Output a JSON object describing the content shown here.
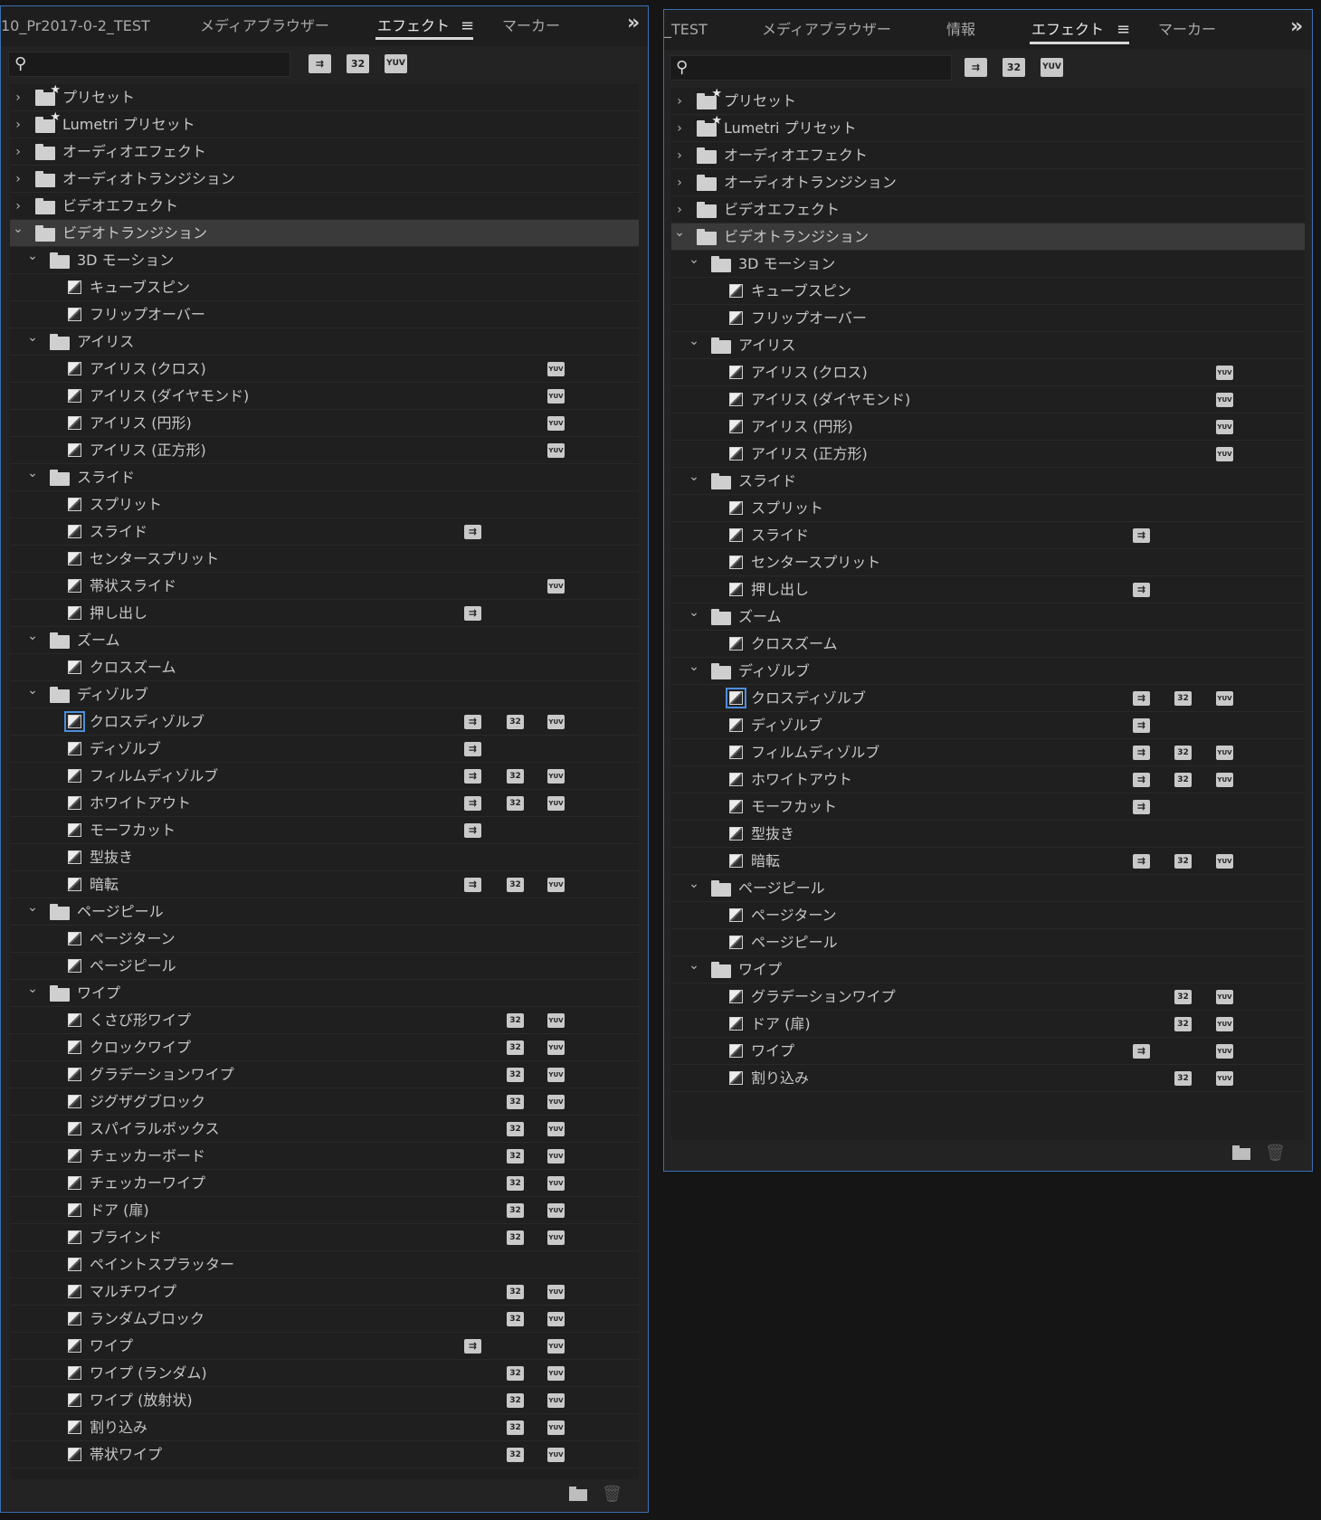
{
  "panel_left": {
    "tabs": [
      "10_Pr2017-0-2_TEST",
      "メディアブラウザー",
      "エフェクト",
      "マーカー"
    ],
    "active_tab": "エフェクト",
    "search": {
      "value": "",
      "placeholder": ""
    },
    "filters": [
      "accelerated",
      "32",
      "YUV"
    ],
    "tree": [
      {
        "type": "folder",
        "level": 0,
        "label": "プリセット",
        "expanded": false,
        "special": true
      },
      {
        "type": "folder",
        "level": 0,
        "label": "Lumetri プリセット",
        "expanded": false,
        "special": true
      },
      {
        "type": "folder",
        "level": 0,
        "label": "オーディオエフェクト",
        "expanded": false
      },
      {
        "type": "folder",
        "level": 0,
        "label": "オーディオトランジション",
        "expanded": false
      },
      {
        "type": "folder",
        "level": 0,
        "label": "ビデオエフェクト",
        "expanded": false
      },
      {
        "type": "folder",
        "level": 0,
        "label": "ビデオトランジション",
        "expanded": true,
        "selected": true
      },
      {
        "type": "folder",
        "level": 1,
        "label": "3D モーション",
        "expanded": true
      },
      {
        "type": "effect",
        "level": 2,
        "label": "キューブスピン",
        "badges": []
      },
      {
        "type": "effect",
        "level": 2,
        "label": "フリップオーバー",
        "badges": []
      },
      {
        "type": "folder",
        "level": 1,
        "label": "アイリス",
        "expanded": true
      },
      {
        "type": "effect",
        "level": 2,
        "label": "アイリス (クロス)",
        "badges": [
          "yuv"
        ]
      },
      {
        "type": "effect",
        "level": 2,
        "label": "アイリス (ダイヤモンド)",
        "badges": [
          "yuv"
        ]
      },
      {
        "type": "effect",
        "level": 2,
        "label": "アイリス (円形)",
        "badges": [
          "yuv"
        ]
      },
      {
        "type": "effect",
        "level": 2,
        "label": "アイリス (正方形)",
        "badges": [
          "yuv"
        ]
      },
      {
        "type": "folder",
        "level": 1,
        "label": "スライド",
        "expanded": true
      },
      {
        "type": "effect",
        "level": 2,
        "label": "スプリット",
        "badges": []
      },
      {
        "type": "effect",
        "level": 2,
        "label": "スライド",
        "badges": [
          "acc"
        ]
      },
      {
        "type": "effect",
        "level": 2,
        "label": "センタースプリット",
        "badges": []
      },
      {
        "type": "effect",
        "level": 2,
        "label": "帯状スライド",
        "badges": [
          "yuv"
        ]
      },
      {
        "type": "effect",
        "level": 2,
        "label": "押し出し",
        "badges": [
          "acc"
        ]
      },
      {
        "type": "folder",
        "level": 1,
        "label": "ズーム",
        "expanded": true
      },
      {
        "type": "effect",
        "level": 2,
        "label": "クロスズーム",
        "badges": []
      },
      {
        "type": "folder",
        "level": 1,
        "label": "ディゾルブ",
        "expanded": true
      },
      {
        "type": "effect",
        "level": 2,
        "label": "クロスディゾルブ",
        "badges": [
          "acc",
          "32",
          "yuv"
        ],
        "focused": true
      },
      {
        "type": "effect",
        "level": 2,
        "label": "ディゾルブ",
        "badges": [
          "acc"
        ]
      },
      {
        "type": "effect",
        "level": 2,
        "label": "フィルムディゾルブ",
        "badges": [
          "acc",
          "32",
          "yuv"
        ]
      },
      {
        "type": "effect",
        "level": 2,
        "label": "ホワイトアウト",
        "badges": [
          "acc",
          "32",
          "yuv"
        ]
      },
      {
        "type": "effect",
        "level": 2,
        "label": "モーフカット",
        "badges": [
          "acc"
        ]
      },
      {
        "type": "effect",
        "level": 2,
        "label": "型抜き",
        "badges": []
      },
      {
        "type": "effect",
        "level": 2,
        "label": "暗転",
        "badges": [
          "acc",
          "32",
          "yuv"
        ]
      },
      {
        "type": "folder",
        "level": 1,
        "label": "ページピール",
        "expanded": true
      },
      {
        "type": "effect",
        "level": 2,
        "label": "ページターン",
        "badges": []
      },
      {
        "type": "effect",
        "level": 2,
        "label": "ページピール",
        "badges": []
      },
      {
        "type": "folder",
        "level": 1,
        "label": "ワイプ",
        "expanded": true
      },
      {
        "type": "effect",
        "level": 2,
        "label": "くさび形ワイプ",
        "badges": [
          "32",
          "yuv"
        ]
      },
      {
        "type": "effect",
        "level": 2,
        "label": "クロックワイプ",
        "badges": [
          "32",
          "yuv"
        ]
      },
      {
        "type": "effect",
        "level": 2,
        "label": "グラデーションワイプ",
        "badges": [
          "32",
          "yuv"
        ]
      },
      {
        "type": "effect",
        "level": 2,
        "label": "ジグザグブロック",
        "badges": [
          "32",
          "yuv"
        ]
      },
      {
        "type": "effect",
        "level": 2,
        "label": "スパイラルボックス",
        "badges": [
          "32",
          "yuv"
        ]
      },
      {
        "type": "effect",
        "level": 2,
        "label": "チェッカーボード",
        "badges": [
          "32",
          "yuv"
        ]
      },
      {
        "type": "effect",
        "level": 2,
        "label": "チェッカーワイプ",
        "badges": [
          "32",
          "yuv"
        ]
      },
      {
        "type": "effect",
        "level": 2,
        "label": "ドア (扉)",
        "badges": [
          "32",
          "yuv"
        ]
      },
      {
        "type": "effect",
        "level": 2,
        "label": "ブラインド",
        "badges": [
          "32",
          "yuv"
        ]
      },
      {
        "type": "effect",
        "level": 2,
        "label": "ペイントスプラッター",
        "badges": []
      },
      {
        "type": "effect",
        "level": 2,
        "label": "マルチワイプ",
        "badges": [
          "32",
          "yuv"
        ]
      },
      {
        "type": "effect",
        "level": 2,
        "label": "ランダムブロック",
        "badges": [
          "32",
          "yuv"
        ]
      },
      {
        "type": "effect",
        "level": 2,
        "label": "ワイプ",
        "badges": [
          "acc",
          "yuv"
        ]
      },
      {
        "type": "effect",
        "level": 2,
        "label": "ワイプ (ランダム)",
        "badges": [
          "32",
          "yuv"
        ]
      },
      {
        "type": "effect",
        "level": 2,
        "label": "ワイプ (放射状)",
        "badges": [
          "32",
          "yuv"
        ]
      },
      {
        "type": "effect",
        "level": 2,
        "label": "割り込み",
        "badges": [
          "32",
          "yuv"
        ]
      },
      {
        "type": "effect",
        "level": 2,
        "label": "帯状ワイプ",
        "badges": [
          "32",
          "yuv"
        ]
      }
    ]
  },
  "panel_right": {
    "tabs": [
      "_TEST",
      "メディアブラウザー",
      "情報",
      "エフェクト",
      "マーカー"
    ],
    "active_tab": "エフェクト",
    "search": {
      "value": "",
      "placeholder": ""
    },
    "filters": [
      "accelerated",
      "32",
      "YUV"
    ],
    "tree": [
      {
        "type": "folder",
        "level": 0,
        "label": "プリセット",
        "expanded": false,
        "special": true
      },
      {
        "type": "folder",
        "level": 0,
        "label": "Lumetri プリセット",
        "expanded": false,
        "special": true
      },
      {
        "type": "folder",
        "level": 0,
        "label": "オーディオエフェクト",
        "expanded": false
      },
      {
        "type": "folder",
        "level": 0,
        "label": "オーディオトランジション",
        "expanded": false
      },
      {
        "type": "folder",
        "level": 0,
        "label": "ビデオエフェクト",
        "expanded": false
      },
      {
        "type": "folder",
        "level": 0,
        "label": "ビデオトランジション",
        "expanded": true,
        "selected": true
      },
      {
        "type": "folder",
        "level": 1,
        "label": "3D モーション",
        "expanded": true
      },
      {
        "type": "effect",
        "level": 2,
        "label": "キューブスピン",
        "badges": []
      },
      {
        "type": "effect",
        "level": 2,
        "label": "フリップオーバー",
        "badges": []
      },
      {
        "type": "folder",
        "level": 1,
        "label": "アイリス",
        "expanded": true
      },
      {
        "type": "effect",
        "level": 2,
        "label": "アイリス (クロス)",
        "badges": [
          "yuv"
        ]
      },
      {
        "type": "effect",
        "level": 2,
        "label": "アイリス (ダイヤモンド)",
        "badges": [
          "yuv"
        ]
      },
      {
        "type": "effect",
        "level": 2,
        "label": "アイリス (円形)",
        "badges": [
          "yuv"
        ]
      },
      {
        "type": "effect",
        "level": 2,
        "label": "アイリス (正方形)",
        "badges": [
          "yuv"
        ]
      },
      {
        "type": "folder",
        "level": 1,
        "label": "スライド",
        "expanded": true
      },
      {
        "type": "effect",
        "level": 2,
        "label": "スプリット",
        "badges": []
      },
      {
        "type": "effect",
        "level": 2,
        "label": "スライド",
        "badges": [
          "acc"
        ]
      },
      {
        "type": "effect",
        "level": 2,
        "label": "センタースプリット",
        "badges": []
      },
      {
        "type": "effect",
        "level": 2,
        "label": "押し出し",
        "badges": [
          "acc"
        ]
      },
      {
        "type": "folder",
        "level": 1,
        "label": "ズーム",
        "expanded": true
      },
      {
        "type": "effect",
        "level": 2,
        "label": "クロスズーム",
        "badges": []
      },
      {
        "type": "folder",
        "level": 1,
        "label": "ディゾルブ",
        "expanded": true
      },
      {
        "type": "effect",
        "level": 2,
        "label": "クロスディゾルブ",
        "badges": [
          "acc",
          "32",
          "yuv"
        ],
        "focused": true
      },
      {
        "type": "effect",
        "level": 2,
        "label": "ディゾルブ",
        "badges": [
          "acc"
        ]
      },
      {
        "type": "effect",
        "level": 2,
        "label": "フィルムディゾルブ",
        "badges": [
          "acc",
          "32",
          "yuv"
        ]
      },
      {
        "type": "effect",
        "level": 2,
        "label": "ホワイトアウト",
        "badges": [
          "acc",
          "32",
          "yuv"
        ]
      },
      {
        "type": "effect",
        "level": 2,
        "label": "モーフカット",
        "badges": [
          "acc"
        ]
      },
      {
        "type": "effect",
        "level": 2,
        "label": "型抜き",
        "badges": []
      },
      {
        "type": "effect",
        "level": 2,
        "label": "暗転",
        "badges": [
          "acc",
          "32",
          "yuv"
        ]
      },
      {
        "type": "folder",
        "level": 1,
        "label": "ページピール",
        "expanded": true
      },
      {
        "type": "effect",
        "level": 2,
        "label": "ページターン",
        "badges": []
      },
      {
        "type": "effect",
        "level": 2,
        "label": "ページピール",
        "badges": []
      },
      {
        "type": "folder",
        "level": 1,
        "label": "ワイプ",
        "expanded": true
      },
      {
        "type": "effect",
        "level": 2,
        "label": "グラデーションワイプ",
        "badges": [
          "32",
          "yuv"
        ]
      },
      {
        "type": "effect",
        "level": 2,
        "label": "ドア (扉)",
        "badges": [
          "32",
          "yuv"
        ]
      },
      {
        "type": "effect",
        "level": 2,
        "label": "ワイプ",
        "badges": [
          "acc",
          "yuv"
        ]
      },
      {
        "type": "effect",
        "level": 2,
        "label": "割り込み",
        "badges": [
          "32",
          "yuv"
        ]
      }
    ]
  },
  "badge_text": {
    "acc": "⇉",
    "32": "32",
    "yuv": "YUV"
  },
  "icons": [
    "search-icon",
    "panel-menu-icon",
    "overflow-chevrons-icon",
    "chevron-right-icon",
    "chevron-down-icon",
    "folder-icon",
    "preset-folder-icon",
    "effect-icon",
    "accelerated-badge-icon",
    "32bit-badge-icon",
    "yuv-badge-icon",
    "new-bin-icon",
    "trash-icon"
  ],
  "colors": {
    "panel_bg": "#232323",
    "tree_bg": "#1f1f1f",
    "border_focus": "#3a6fb3",
    "selected_row": "#3a3a3a",
    "text": "#c8c8c8",
    "app_bg": "#151515"
  }
}
